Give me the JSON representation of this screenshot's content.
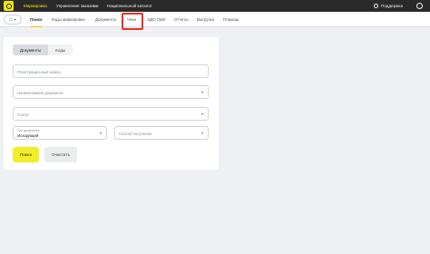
{
  "topbar": {
    "items": [
      {
        "label": "Маркировка"
      },
      {
        "label": "Управление заказами"
      },
      {
        "label": "Национальный каталог"
      }
    ],
    "support_label": "Поддержка"
  },
  "subnav": {
    "tabs": [
      {
        "label": "Поиск"
      },
      {
        "label": "Коды маркировки"
      },
      {
        "label": "Документы"
      },
      {
        "label": "Чеки"
      },
      {
        "label": "ЭДО Лайт"
      },
      {
        "label": "Отчеты"
      },
      {
        "label": "Выгрузки"
      },
      {
        "label": "Помощь"
      }
    ]
  },
  "search": {
    "segments": [
      {
        "label": "Документы"
      },
      {
        "label": "Коды"
      }
    ],
    "fields": {
      "reg_number_placeholder": "Регистрационный номер",
      "doc_name_placeholder": "Наименование документа",
      "status_placeholder": "Статус",
      "doc_type_label": "Тип документа",
      "doc_type_value": "Исходящий",
      "receive_method_placeholder": "Способ получения"
    },
    "search_button": "Поиск",
    "clear_button": "Очистить"
  },
  "colors": {
    "accent": "#f2ee2a",
    "highlight": "#e53228",
    "topbar": "#2a2a2a"
  }
}
